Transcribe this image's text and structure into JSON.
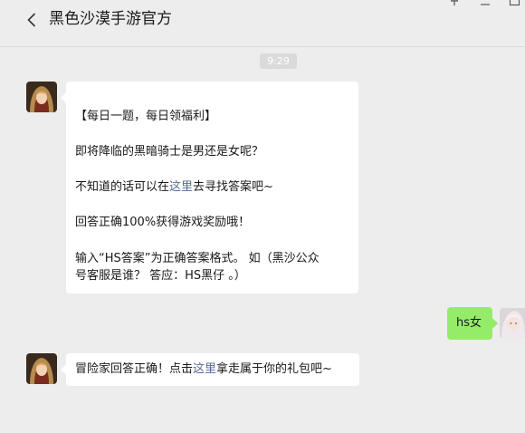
{
  "header": {
    "title": "黑色沙漠手游官方",
    "back_icon": "chevron-left-icon",
    "pin_icon": "pin-icon",
    "minimize_icon": "minimize-icon",
    "maximize_icon": "maximize-icon"
  },
  "chat": {
    "timestamp": "9:29",
    "messages": [
      {
        "sender": "bot",
        "lines": [
          "【每日一题，每日领福利】",
          "即将降临的黑暗骑士是男还是女呢？",
          {
            "before": "不知道的话可以在",
            "link": "这里",
            "after": "去寻找答案吧~"
          },
          "回答正确100%获得游戏奖励哦！",
          "输入“HS答案”为正确答案格式。 如（黑沙公众",
          "号客服是谁？ 答应：HS黑仔 。）"
        ]
      },
      {
        "sender": "user",
        "text": "hs女"
      },
      {
        "sender": "bot",
        "before": "冒险家回答正确！点击",
        "link": "这里",
        "after": "拿走属于你的礼包吧~"
      }
    ]
  },
  "colors": {
    "background": "#ededed",
    "incoming_bubble": "#ffffff",
    "outgoing_bubble": "#95ec69",
    "link": "#576b95",
    "timestamp_bg": "#dadada"
  }
}
